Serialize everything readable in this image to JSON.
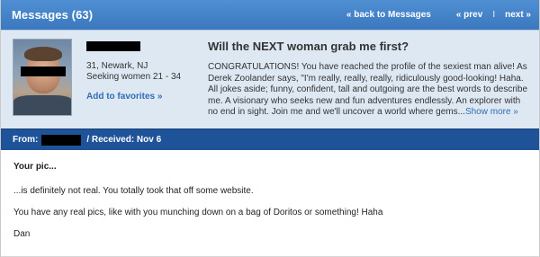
{
  "header": {
    "title": "Messages (63)",
    "back_label": "« back to Messages",
    "prev_label": "« prev",
    "separator": "I",
    "next_label": "next »"
  },
  "profile": {
    "location": "31, Newark, NJ",
    "seeking": "Seeking women 21 - 34",
    "add_favorites": "Add to favorites »",
    "headline": "Will the NEXT woman grab me first?",
    "bio": "CONGRATULATIONS! You have reached the profile of the sexiest man alive! As Derek Zoolander says, \"I'm really, really, really, ridiculously good-looking! Haha. All jokes aside; funny, confident, tall and outgoing are the best words to describe me. A visionary who seeks new and fun adventures endlessly. An explorer with no end in sight. Join me and we'll uncover a world where gems...",
    "show_more": "Show more »"
  },
  "meta": {
    "from_label": "From:",
    "received": "/ Received: Nov 6"
  },
  "message": {
    "subject": "Your pic...",
    "line1": "...is definitely not real. You totally took that off some website.",
    "line2": "You have any real pics, like with you munching down on a bag of Doritos or something! Haha",
    "line3": "Dan"
  },
  "colors": {
    "header_blue": "#3b78bf",
    "profile_bg": "#dde8f3",
    "meta_blue": "#1f5399",
    "link_blue": "#2f6db5"
  }
}
